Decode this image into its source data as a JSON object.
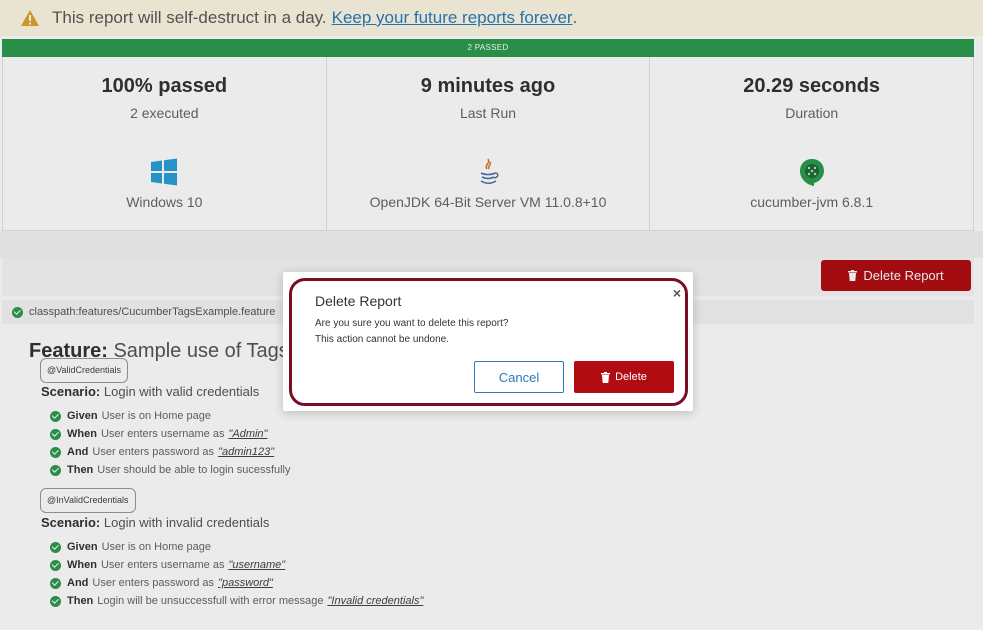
{
  "banner": {
    "message": "This report will self-destruct in a day.",
    "link": "Keep your future reports forever",
    "suffix": "."
  },
  "status_bar": {
    "label": "2 PASSED"
  },
  "stats": {
    "passed": {
      "value": "100% passed",
      "sub": "2 executed"
    },
    "last_run": {
      "value": "9 minutes ago",
      "sub": "Last Run"
    },
    "duration": {
      "value": "20.29 seconds",
      "sub": "Duration"
    },
    "os": {
      "icon": "windows-icon",
      "label": "Windows 10"
    },
    "jvm": {
      "icon": "java-icon",
      "label": "OpenJDK 64-Bit Server VM 11.0.8+10"
    },
    "tool": {
      "icon": "cucumber-icon",
      "label": "cucumber-jvm 6.8.1"
    }
  },
  "toolbar": {
    "delete_report_label": "Delete Report"
  },
  "feature": {
    "path": "classpath:features/CucumberTagsExample.feature",
    "keyword": "Feature:",
    "name": "Sample use of Tags",
    "scenarios": [
      {
        "tag": "@ValidCredentials",
        "keyword": "Scenario:",
        "name": "Login with valid credentials",
        "steps": [
          {
            "keyword": "Given",
            "text": "User is on Home page",
            "arg": ""
          },
          {
            "keyword": "When",
            "text": "User enters username as",
            "arg": "\"Admin\""
          },
          {
            "keyword": "And",
            "text": "User enters password as",
            "arg": "\"admin123\""
          },
          {
            "keyword": "Then",
            "text": "User should be able to login sucessfully",
            "arg": ""
          }
        ]
      },
      {
        "tag": "@InValidCredentials",
        "keyword": "Scenario:",
        "name": "Login with invalid credentials",
        "steps": [
          {
            "keyword": "Given",
            "text": "User is on Home page",
            "arg": ""
          },
          {
            "keyword": "When",
            "text": "User enters username as",
            "arg": "\"username\""
          },
          {
            "keyword": "And",
            "text": "User enters password as",
            "arg": "\"password\""
          },
          {
            "keyword": "Then",
            "text": "Login will be unsuccessfull with error message",
            "arg": "\"Invalid credentials\""
          }
        ]
      }
    ]
  },
  "modal": {
    "title": "Delete Report",
    "close": "×",
    "message_line1": "Are you sure you want to delete this report?",
    "message_line2": "This action cannot be undone.",
    "cancel_label": "Cancel",
    "delete_label": "Delete"
  },
  "colors": {
    "passed": "#2d9b4e",
    "danger": "#b00c11",
    "link": "#2a7bbf",
    "modal_ring": "#7a0c25"
  }
}
